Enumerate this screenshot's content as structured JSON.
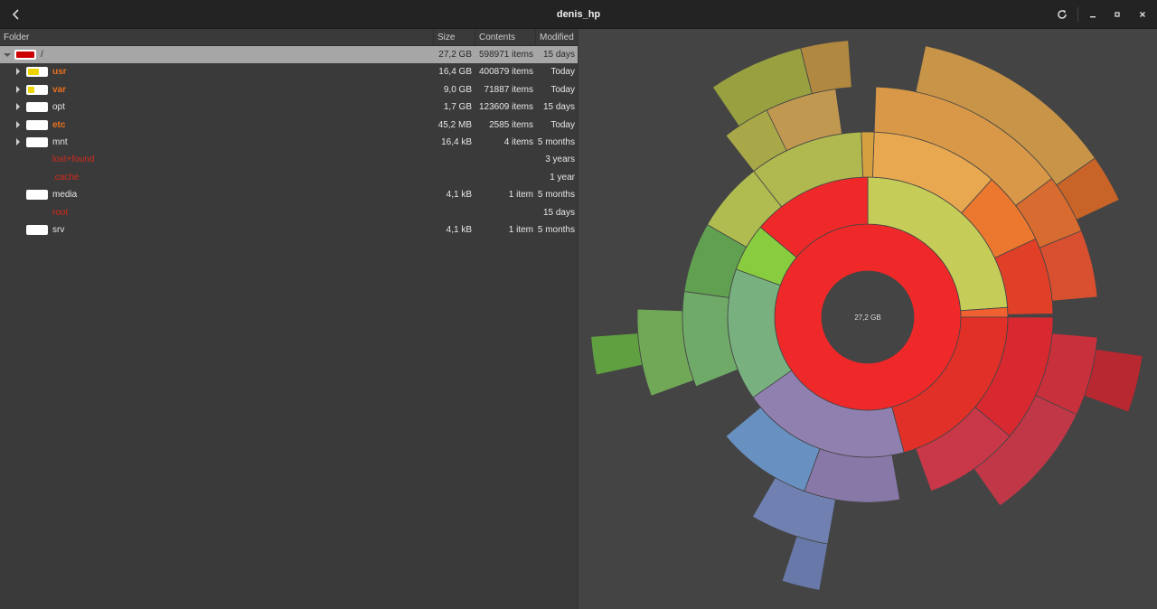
{
  "window": {
    "title": "denis_hp"
  },
  "columns": {
    "folder": "Folder",
    "size": "Size",
    "contents": "Contents",
    "modified": "Modified"
  },
  "rows": [
    {
      "name": "/",
      "size": "27,2 GB",
      "contents": "598971 items",
      "modified": "15 days",
      "level": "error",
      "usage": 1.0,
      "bar_color": "#cc0000",
      "expander": "down",
      "indent": 0,
      "selected": true
    },
    {
      "name": "usr",
      "size": "16,4 GB",
      "contents": "400879 items",
      "modified": "Today",
      "level": "warn",
      "usage": 0.6,
      "bar_color": "#edd400",
      "expander": "right",
      "indent": 1
    },
    {
      "name": "var",
      "size": "9,0 GB",
      "contents": "71887 items",
      "modified": "Today",
      "level": "warn",
      "usage": 0.33,
      "bar_color": "#edd400",
      "expander": "right",
      "indent": 1
    },
    {
      "name": "opt",
      "size": "1,7 GB",
      "contents": "123609 items",
      "modified": "15 days",
      "level": "normal",
      "usage": 0.0,
      "bar_color": "#ffffff",
      "expander": "right",
      "indent": 1
    },
    {
      "name": "etc",
      "size": "45,2 MB",
      "contents": "2585 items",
      "modified": "Today",
      "level": "warn",
      "usage": 0.0,
      "bar_color": "#ffffff",
      "expander": "right",
      "indent": 1
    },
    {
      "name": "mnt",
      "size": "16,4 kB",
      "contents": "4 items",
      "modified": "5 months",
      "level": "normal",
      "usage": 0.0,
      "bar_color": "#ffffff",
      "expander": "right",
      "indent": 1
    },
    {
      "name": "lost+found",
      "size": "",
      "contents": "",
      "modified": "3 years",
      "level": "error",
      "usage": null,
      "expander": "none",
      "indent": 1
    },
    {
      "name": ".cache",
      "size": "",
      "contents": "",
      "modified": "1 year",
      "level": "error",
      "usage": null,
      "expander": "none",
      "indent": 1
    },
    {
      "name": "media",
      "size": "4,1 kB",
      "contents": "1 item",
      "modified": "5 months",
      "level": "normal",
      "usage": 0.0,
      "bar_color": "#ffffff",
      "expander": "none",
      "indent": 1
    },
    {
      "name": "root",
      "size": "",
      "contents": "",
      "modified": "15 days",
      "level": "error",
      "usage": null,
      "expander": "none",
      "indent": 1
    },
    {
      "name": "srv",
      "size": "4,1 kB",
      "contents": "1 item",
      "modified": "5 months",
      "level": "normal",
      "usage": 0.0,
      "bar_color": "#ffffff",
      "expander": "none",
      "indent": 1
    }
  ],
  "chart": {
    "center_label": "27,2 GB"
  },
  "icons": {
    "back": "chevron-left-icon",
    "reload": "reload-icon",
    "minimize": "minimize-icon",
    "maximize": "maximize-icon",
    "close": "close-icon"
  }
}
